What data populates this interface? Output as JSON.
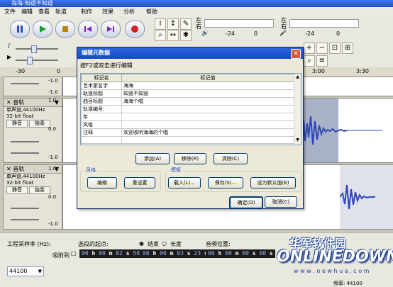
{
  "window": {
    "title": "海海-知道不知道"
  },
  "menu": [
    "文件",
    "编辑",
    "查看",
    "轨道",
    "制作",
    "效果",
    "分析",
    "帮助"
  ],
  "toolbar": {
    "meter_left": "左",
    "meter_right": "右",
    "meter_ticks": [
      "-24",
      "0",
      "-24",
      "0"
    ]
  },
  "ruler": {
    "labels": [
      "-30",
      "0",
      "30",
      "3:00",
      "3:30"
    ]
  },
  "tracks": [
    {
      "name": "音轨",
      "info1": "单声道,44100Hz",
      "info2": "32-bit float",
      "mute": "静音",
      "solo": "独奏",
      "scale": [
        "-1.0",
        "1.0",
        "0.0",
        "-1.0"
      ]
    },
    {
      "name": "音轨",
      "info1": "单声道,44100Hz",
      "info2": "32-bit float",
      "mute": "静音",
      "solo": "独奏",
      "scale": [
        "1.0",
        "0.0",
        "-1.0"
      ]
    }
  ],
  "dialog": {
    "title": "编辑元数据",
    "hint": "按F2或双击进行编辑",
    "columns": [
      "标记名",
      "标记值"
    ],
    "rows": [
      [
        "艺术家名字",
        "海海"
      ],
      [
        "轨道标题",
        "知道不知道"
      ],
      [
        "曲目标题",
        "海海个唱"
      ],
      [
        "轨道编号:",
        ""
      ],
      [
        "年",
        ""
      ],
      [
        "风格",
        ""
      ],
      [
        "注释",
        "欢迎收听海海的个唱"
      ],
      [
        "",
        ""
      ]
    ],
    "add": "添加(A)",
    "remove": "移除(R)",
    "clear": "清除(C)",
    "genre_group": "风格",
    "edit": "编辑",
    "reset": "重设置",
    "template_group": "模板",
    "load": "载入(L)...",
    "save": "保存(S)...",
    "set_default": "设为默认值(E)",
    "ok": "确定(O)",
    "cancel": "取消(C)"
  },
  "bottom": {
    "rate_label": "工程采样率 (Hz):",
    "rate_value": "44100",
    "snap": "吸附到",
    "sel_start_label": "选段的起点:",
    "end_label": "结束",
    "length_label": "长度",
    "audio_pos_label": "音频位置:",
    "tc_start": [
      "00",
      "00",
      "02",
      "58"
    ],
    "tc_end": [
      "00",
      "00",
      "03",
      "23"
    ],
    "tc_pos": [
      "00",
      "00",
      "00",
      "00"
    ],
    "tc_units": [
      "h",
      "m",
      "s"
    ],
    "status": "频率: 44100"
  },
  "watermark": {
    "cn": "华军软件园",
    "en": "ONLINEDOWN",
    "url": "w w w . n e w h u a . c o m"
  },
  "colors": {
    "dialog_title": "#2d65e0",
    "wave": "#2f47b8",
    "selection": "#a9b1c9"
  }
}
